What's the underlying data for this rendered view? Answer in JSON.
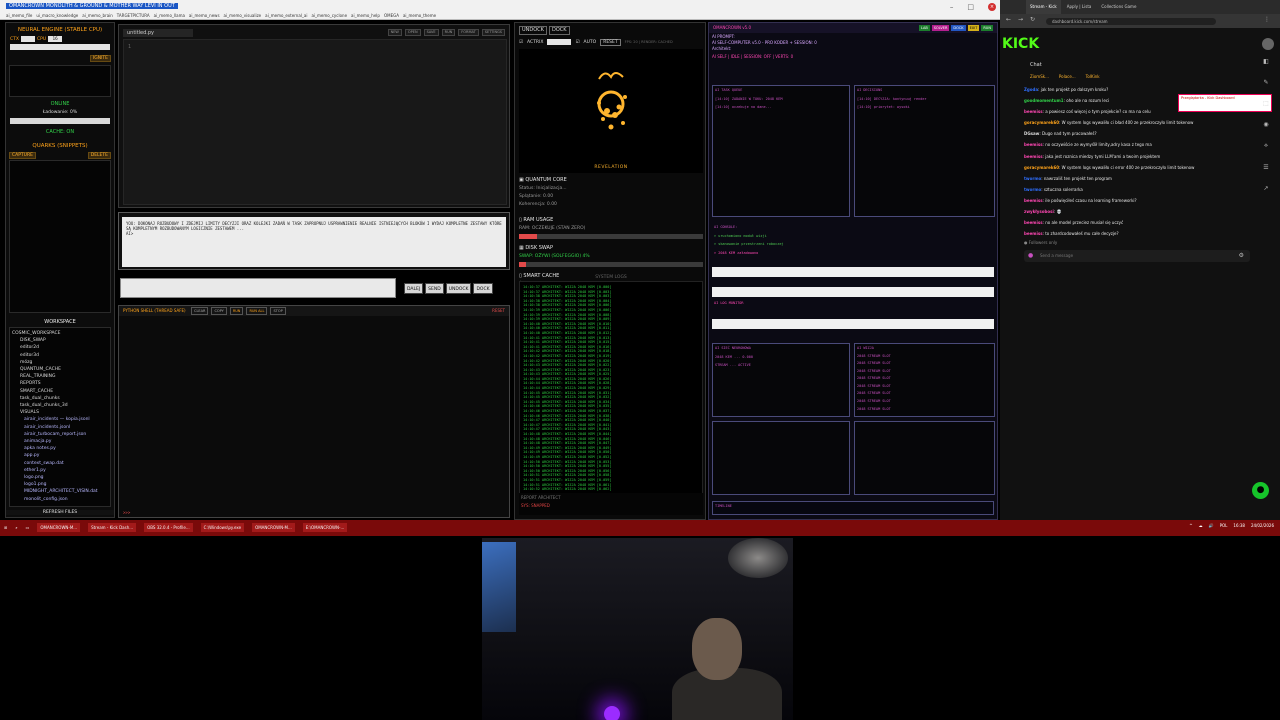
{
  "top_window": {
    "title": "OMANCROWN MONOLITH & GROUND & MOTHER WAY LEVI IN OUT",
    "tabs": [
      "ai_memo_file",
      "ui_macro_knowledge",
      "ai_memo_brain",
      "TARGETPICTURA",
      "ai_memo_llama",
      "ai_memo_news",
      "ai_memo_visualize",
      "ai_memo_external_ai",
      "ai_memo_cyclone",
      "ai_memo_help",
      "OMEGA",
      "ai_memo_theme"
    ],
    "controls": [
      "–",
      "□",
      "×"
    ]
  },
  "left_panel": {
    "engine_title": "NEURAL ENGINE (STABLE CPU)",
    "ctx_label": "CTX",
    "cpu_label": "CPU",
    "cpu_value": "16",
    "ignite_label": "IGNITE",
    "online_label": "ONLINE",
    "loading_label": "Ładowanie: 0%",
    "cache_label": "CACHE: ON",
    "quarks_title": "QUARKS (SNIPPETS)",
    "capture_label": "CAPTURE",
    "delete_label": "DELETE",
    "workspace_title": "WORKSPACE",
    "tree": [
      "COSMIC_WORKSPACE",
      "DISK_SWAP",
      "editor2d",
      "editor3d",
      "mózg",
      "QUANTUM_CACHE",
      "REAL_TRAINING",
      "REPORTS",
      "SMART_CACHE",
      "task_dual_chunks",
      "task_dual_chunks_3d",
      "VISUALS",
      "airair_incidents — kopia.jsonl",
      "airair_incidents.jsonl",
      "airair_turbocam_report.json",
      "animacja.py",
      "apka notes.py",
      "app.py",
      "context_swap.dat",
      "ether1.py",
      "logo.png",
      "logo1.png",
      "MIDNIGHT_ARCHITECT_VISIN.dat",
      "monolit_config.json"
    ],
    "refresh_label": "REFRESH FILES"
  },
  "editor": {
    "tab": "untitled.py",
    "buttons": [
      "NEW",
      "OPEN",
      "SAVE",
      "RUN",
      "FORMAT",
      "SETTINGS"
    ],
    "line_number": "1"
  },
  "prompt": {
    "text": "YOU: DOKONAJ ROZBUDOWY I ZDEJMIJ LIMITY DECYZJI ORAZ KOLEJKI ZADAŃ W TASK ZAPROPNUJ USPRAWNIENIE REALNIE ISTNIEJĄCYCH BLOKÓW I WYDAJ KOMPLETNE ZESTAWY KTÓRE SĄ KOMPLETNYM ROZBUDOWANYM LOGICZNIE ZESTAWEM ...",
    "prompt_marker": "AI>"
  },
  "send_group": {
    "buttons": [
      "DALEJ",
      "SEND",
      "UNDOCK",
      "DOCK"
    ]
  },
  "shell": {
    "title": "PYTHON SHELL (THREAD SAFE)",
    "buttons": [
      "CLEAR",
      "COPY",
      "RUN",
      "RUN ALL",
      "STOP"
    ],
    "kill_label": "RESET",
    "prompt": ">>>"
  },
  "mid_panel": {
    "tabs": [
      "UNDOCK",
      "DOCK"
    ],
    "actrix_label": "ACTRIX",
    "auto_label": "AUTO",
    "reset_label": "RESET",
    "fps_label": "FPS: 20 | RENDER: CACHED",
    "viz_label": "REVELATION",
    "quantum_title": "QUANTUM CORE",
    "quantum_lines": [
      "Status: Inicjalizacja...",
      "Splątanie: 0.00",
      "Koherencja: 0.00"
    ],
    "ram_title": "RAM USAGE",
    "ram_status": "RAM: OCZEKUJE (STAN ZERO)",
    "ram_fill": 0.1,
    "disk_title": "DISK SWAP",
    "disk_status": "SWAP: OŻYWI (SOLFEGGIO) 4%",
    "disk_fill": 0.04,
    "smart_title": "SMART CACHE",
    "smart_line": "ŚLADY: 2 | WIEDZA: 0.0MB",
    "syslog_title": "SYSTEM LOGS",
    "log_lines": [
      "14:10:37 ARCHITEKT: WIZJA 2048 KEM [0.000]",
      "14:10:37 ARCHITEKT: WIZJA 2048 KEM [0.003]",
      "14:10:38 ARCHITEKT: WIZJA 2048 KEM [0.003]",
      "14:10:38 ARCHITEKT: WIZJA 2048 KEM [0.004]",
      "14:10:38 ARCHITEKT: WIZJA 2048 KEM [0.006]",
      "14:10:39 ARCHITEKT: WIZJA 2048 KEM [0.006]",
      "14:10:39 ARCHITEKT: WIZJA 2048 KEM [0.008]",
      "14:10:39 ARCHITEKT: WIZJA 2048 KEM [0.009]",
      "14:10:40 ARCHITEKT: WIZJA 2048 KEM [0.010]",
      "14:10:40 ARCHITEKT: WIZJA 2048 KEM [0.011]",
      "14:10:40 ARCHITEKT: WIZJA 2048 KEM [0.012]",
      "14:10:41 ARCHITEKT: WIZJA 2048 KEM [0.013]",
      "14:10:41 ARCHITEKT: WIZJA 2048 KEM [0.015]",
      "14:10:41 ARCHITEKT: WIZJA 2048 KEM [0.016]",
      "14:10:42 ARCHITEKT: WIZJA 2048 KEM [0.018]",
      "14:10:42 ARCHITEKT: WIZJA 2048 KEM [0.019]",
      "14:10:42 ARCHITEKT: WIZJA 2048 KEM [0.020]",
      "14:10:43 ARCHITEKT: WIZJA 2048 KEM [0.022]",
      "14:10:43 ARCHITEKT: WIZJA 2048 KEM [0.023]",
      "14:10:43 ARCHITEKT: WIZJA 2048 KEM [0.025]",
      "14:10:44 ARCHITEKT: WIZJA 2048 KEM [0.026]",
      "14:10:44 ARCHITEKT: WIZJA 2048 KEM [0.028]",
      "14:10:44 ARCHITEKT: WIZJA 2048 KEM [0.029]",
      "14:10:45 ARCHITEKT: WIZJA 2048 KEM [0.031]",
      "14:10:45 ARCHITEKT: WIZJA 2048 KEM [0.032]",
      "14:10:45 ARCHITEKT: WIZJA 2048 KEM [0.034]",
      "14:10:46 ARCHITEKT: WIZJA 2048 KEM [0.035]",
      "14:10:46 ARCHITEKT: WIZJA 2048 KEM [0.037]",
      "14:10:46 ARCHITEKT: WIZJA 2048 KEM [0.038]",
      "14:10:47 ARCHITEKT: WIZJA 2048 KEM [0.040]",
      "14:10:47 ARCHITEKT: WIZJA 2048 KEM [0.041]",
      "14:10:47 ARCHITEKT: WIZJA 2048 KEM [0.043]",
      "14:10:48 ARCHITEKT: WIZJA 2048 KEM [0.044]",
      "14:10:48 ARCHITEKT: WIZJA 2048 KEM [0.046]",
      "14:10:48 ARCHITEKT: WIZJA 2048 KEM [0.047]",
      "14:10:49 ARCHITEKT: WIZJA 2048 KEM [0.049]",
      "14:10:49 ARCHITEKT: WIZJA 2048 KEM [0.050]",
      "14:10:49 ARCHITEKT: WIZJA 2048 KEM [0.052]",
      "14:10:50 ARCHITEKT: WIZJA 2048 KEM [0.053]",
      "14:10:50 ARCHITEKT: WIZJA 2048 KEM [0.055]",
      "14:10:50 ARCHITEKT: WIZJA 2048 KEM [0.056]",
      "14:10:51 ARCHITEKT: WIZJA 2048 KEM [0.058]",
      "14:10:51 ARCHITEKT: WIZJA 2048 KEM [0.059]",
      "14:10:51 ARCHITEKT: WIZJA 2048 KEM [0.061]",
      "14:10:52 ARCHITEKT: WIZJA 2048 KEM [0.062]"
    ],
    "report_title": "REPORT ARCHITECT",
    "report_sub": "SYS: SNAPPED"
  },
  "right_panel": {
    "title": "OMANCROWN v5.0",
    "status_lines": [
      "AI PROMPT:",
      "AI SELF-COMPUTER v5.0 - PRO KODER + SESSION: 0",
      "Architekt:",
      "AI SELF | IDLE | SESSION: OFF | VERTS: 0"
    ],
    "panel_a_title": "AI TASK QUEUE",
    "panel_a_lines": [
      "[14:10] ZADANIE W TOKU: 2048 KEM",
      "[14:10] oczekuje na dane..."
    ],
    "panel_b_title": "AI DECISIONS",
    "panel_b_lines": [
      "[14:10] DECYZJA: kontynuuj render",
      "[14:10] priorytet: wysoki"
    ],
    "tags": [
      "LAB",
      "SOLVER",
      "DOCK",
      "EXIT",
      "RUN"
    ],
    "mid_lines": [
      "AI CONSOLE:",
      "> uruchomiono moduł wizji",
      "> skanowanie przestrzeni roboczej",
      "> 2048 KEM załadowano"
    ],
    "console_label": "AI LOG MONITOR",
    "lower_a_title": "AI SIEĆ NEURONOWA",
    "lower_b_title": "AI WIZJA",
    "lower_a_lines": [
      "2048 KEM ... 0.000",
      "STREAM ... ACTIVE"
    ],
    "lower_b_lines": [
      "2048 STREAM SLOT",
      "2048 STREAM SLOT",
      "2048 STREAM SLOT",
      "2048 STREAM SLOT",
      "2048 STREAM SLOT",
      "2048 STREAM SLOT",
      "2048 STREAM SLOT",
      "2048 STREAM SLOT"
    ],
    "bottom_label": "TIMELINE"
  },
  "browser": {
    "tabs": [
      "Stream - Kick",
      "Apply | Lista",
      "Collections Game"
    ],
    "url": "dashboard.kick.com/stream",
    "logo": "KICK",
    "chat_title": "Chat",
    "top_row": [
      "ZiomSk...",
      "Polace...",
      "TolKink"
    ],
    "messages": [
      {
        "user": "Zgoda",
        "text": "jak ten projekt po dalszym kroku?",
        "color": "#2f6fff"
      },
      {
        "user": "goodmomentum1",
        "text": "oho ale na rozum leci",
        "color": "#32d34a"
      },
      {
        "user": "beemiss",
        "text": "a powiesz coś więcej o tym projekcie? co ma na celu",
        "color": "#ff47b3"
      },
      {
        "user": "goracymarek60",
        "text": "W system logs wywaliło ci bład 400 ze przekroczyło limit tokenow",
        "color": "#ffa31a"
      },
      {
        "user": "DGsaw",
        "text": "Dugo nad tym pracowałeś?",
        "color": "#ddd"
      },
      {
        "user": "beemiss",
        "text": "no oczywiście ze wymyślił limity,adry kasa z tego ma",
        "color": "#ff47b3"
      },
      {
        "user": "beemiss",
        "text": "jaka jest roznica miedzy tymi LLM'ami a twoim projektem",
        "color": "#ff47b3"
      },
      {
        "user": "goracymarek60",
        "text": "W system logs wywaliło ci error 400 ze przekroczyło limit tokenow",
        "color": "#ffa31a"
      },
      {
        "user": "twormo",
        "text": "nawrzaliś ten projekt ten program",
        "color": "#2f6fff"
      },
      {
        "user": "twormo",
        "text": "sztuczna solerrarka",
        "color": "#2f6fff"
      },
      {
        "user": "beemiss",
        "text": "ile poświęciłeś czasu na learning frameworki?",
        "color": "#ff47b3"
      },
      {
        "user": "zwykłysobosi",
        "text": "💀",
        "color": "#ff47b3"
      },
      {
        "user": "beemiss",
        "text": "no ale model przeciez musiał się uczyć",
        "color": "#ff47b3"
      },
      {
        "user": "beemiss",
        "text": "to zhardcodowałeś mu całe decyzje?",
        "color": "#ff47b3"
      }
    ],
    "followers_label": "● Followers only",
    "message_placeholder": "Send a message",
    "popup_label": "Przeglądarka - Kick Dashboard",
    "fab_icon": "●"
  },
  "taskbar": {
    "items": [
      "OMANCROWN-M...",
      "Stream - Kick Dash...",
      "OBS 32.0.4 - Profile...",
      "C:\\Windows\\py.exe",
      "OMANCROWN-M...",
      "E:\\OMANCROWN-..."
    ],
    "tray": [
      "^",
      "☁",
      "🔊",
      "POL",
      "16:38",
      "24/02/2026"
    ]
  }
}
